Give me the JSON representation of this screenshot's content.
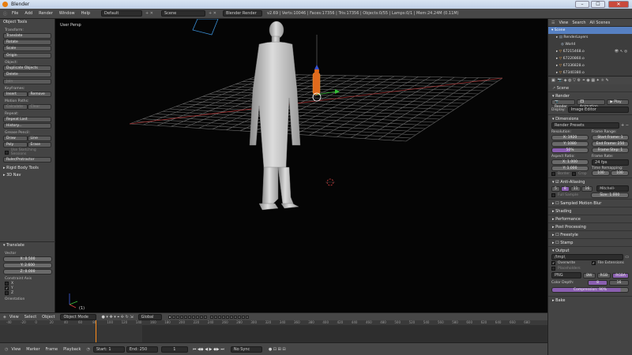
{
  "window": {
    "title": "Blender",
    "minimize": "–",
    "maximize": "☐",
    "close": "✕"
  },
  "header": {
    "menus": [
      "File",
      "Add",
      "Render",
      "Window",
      "Help"
    ],
    "screen": "Default",
    "scene": "Scene",
    "engine": "Blender Render",
    "stats": "v2.69 | Verts:10046 | Faces:17356 | Tris:17356 | Objects:0/55 | Lamps:0/1 | Mem:24.24M (0.11M)"
  },
  "toolshelf": {
    "tab": "Object Tools",
    "transform": {
      "label": "Transform:",
      "buttons": [
        "Translate",
        "Rotate",
        "Scale"
      ],
      "origin": "Origin"
    },
    "object": {
      "label": "Object:",
      "buttons": [
        "Duplicate Objects",
        "Delete"
      ],
      "join": "Join"
    },
    "keyframes": {
      "label": "Keyframes:",
      "insert": "Insert",
      "remove": "Remove"
    },
    "motion": {
      "label": "Motion Paths:",
      "calculate": "Calculate",
      "clear": "Clear"
    },
    "repeat": {
      "label": "Repeat:",
      "last": "Repeat Last",
      "history": "History..."
    },
    "grease": {
      "label": "Grease Pencil:",
      "draw": "Draw",
      "line": "Line",
      "poly": "Poly",
      "erase": "Erase",
      "sketch": "Use Sketching Sessions",
      "ruler": "Ruler/Protractor"
    },
    "rigid": "Rigid Body Tools",
    "nav": "3D Nav",
    "operator": {
      "title": "Translate",
      "vector_label": "Vector",
      "x": "X: 0.500",
      "y": "Y: 2.600",
      "z": "Z: 0.000",
      "constraint_label": "Constraint Axis",
      "axes": [
        {
          "name": "X",
          "checked": false
        },
        {
          "name": "Y",
          "checked": true
        },
        {
          "name": "Z",
          "checked": false
        }
      ],
      "orientation_label": "Orientation"
    }
  },
  "viewport": {
    "view_label": "User Persp",
    "object_label": "(1)"
  },
  "view3d_header": {
    "menus": [
      "View",
      "Select",
      "Object"
    ],
    "mode": "Object Mode",
    "orientation": "Global"
  },
  "timeline": {
    "ruler": [
      "-40",
      "-20",
      "0",
      "20",
      "40",
      "60",
      "80",
      "100",
      "120",
      "140",
      "160",
      "180",
      "200",
      "220",
      "240",
      "260",
      "280",
      "300",
      "320",
      "340",
      "360",
      "380",
      "400",
      "420",
      "440",
      "460",
      "480",
      "500",
      "520",
      "540",
      "560",
      "580",
      "600",
      "620",
      "640",
      "660",
      "680"
    ],
    "current_frame": 1,
    "menus": [
      "View",
      "Marker",
      "Frame",
      "Playback"
    ],
    "start": "Start: 1",
    "end": "End: 250",
    "frame": "1",
    "sync": "No Sync"
  },
  "outliner": {
    "menus": [
      "View",
      "Search",
      "All Scenes"
    ],
    "items": [
      {
        "label": "Scene",
        "selected": true
      },
      {
        "label": "RenderLayers",
        "selected": false
      },
      {
        "label": "World",
        "selected": false
      },
      {
        "label": "67215468.o",
        "selected": false
      },
      {
        "label": "67220860.o",
        "selected": false
      },
      {
        "label": "67336828.o",
        "selected": false
      },
      {
        "label": "67340380.o",
        "selected": false
      }
    ]
  },
  "properties": {
    "scene": "Scene",
    "render_title": "Render",
    "render_btn": "Render",
    "animation_btn": "Animation",
    "play_btn": "Play",
    "display_label": "Display:",
    "display_value": "Image Editor",
    "dimensions_title": "Dimensions",
    "presets": "Render Presets",
    "resolution_label": "Resolution:",
    "res_x": "X: 1920",
    "res_y": "Y: 1080",
    "res_pct": "50%",
    "frame_range_label": "Frame Range:",
    "start_frame": "Start Frame: 1",
    "end_frame": "End Frame: 250",
    "frame_step": "Frame Step: 1",
    "aspect_label": "Aspect Ratio:",
    "aspect_x": "X: 1.000",
    "aspect_y": "Y: 1.000",
    "frame_rate_label": "Frame Rate:",
    "fps": "24 fps",
    "time_remap_label": "Time Remapping:",
    "remap_old": "100",
    "remap_new": "100",
    "border": "Border",
    "crop": "Crop",
    "aa_title": "Anti-Aliasing",
    "aa_samples": [
      "5",
      "8",
      "11",
      "16"
    ],
    "aa_filter": "Mitchell-Netravali",
    "full_sample": "Full Sample",
    "aa_size": "Size: 1.000",
    "panels": [
      "Sampled Motion Blur",
      "Shading",
      "Performance",
      "Post Processing",
      "Freestyle",
      "Stamp"
    ],
    "output_title": "Output",
    "output_path": "/tmp\\",
    "overwrite": "Overwrite",
    "file_ext": "File Extensions",
    "placeholders": "Placeholders",
    "format": "PNG",
    "color_modes": [
      "BW",
      "RGB",
      "RGBA"
    ],
    "color_depth_label": "Color Depth:",
    "depths": [
      "8",
      "16"
    ],
    "compression": "Compression: 90%",
    "bake_title": "Bake"
  }
}
